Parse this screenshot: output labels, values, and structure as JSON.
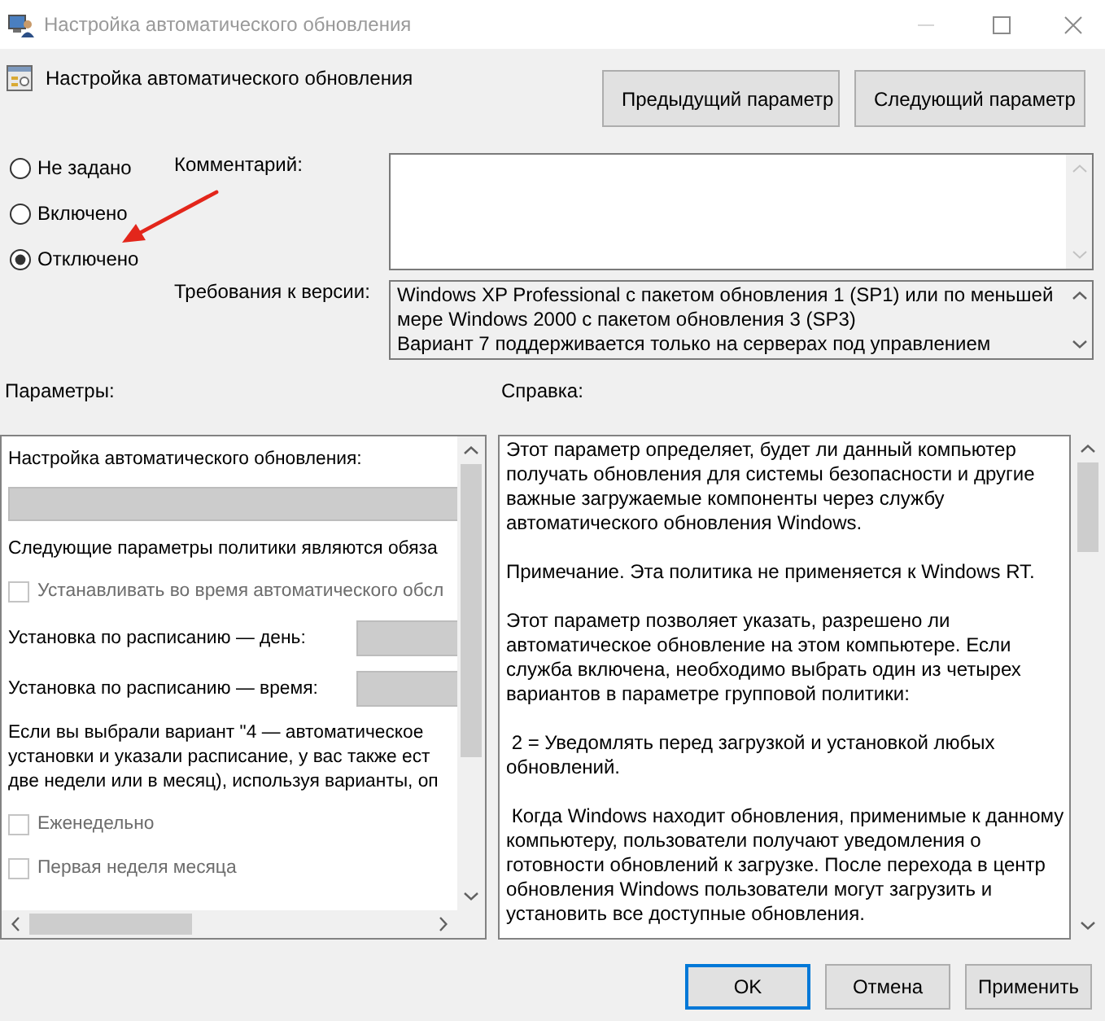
{
  "window": {
    "title": "Настройка автоматического обновления"
  },
  "header": {
    "title": "Настройка автоматического обновления",
    "buttons": [
      "Предыдущий параметр",
      "Следующий параметр"
    ]
  },
  "state_options": [
    {
      "label": "Не задано",
      "selected": false
    },
    {
      "label": "Включено",
      "selected": false
    },
    {
      "label": "Отключено",
      "selected": true
    }
  ],
  "comment": {
    "label": "Комментарий:"
  },
  "version": {
    "label": "Требования к версии:",
    "text": "Windows XP Professional с пакетом обновления 1 (SP1) или по меньшей\nмере Windows 2000 с пакетом обновления 3 (SP3)\nВариант 7 поддерживается только на серверах под управлением"
  },
  "options_panel": {
    "label": "Параметры:",
    "items": [
      {
        "kind": "label",
        "text": "Настройка автоматического обновления:"
      },
      {
        "kind": "dropdown",
        "disabled": true
      },
      {
        "kind": "label",
        "text": "Следующие параметры политики являются обяза"
      },
      {
        "kind": "checkbox",
        "label": "Устанавливать во время автоматического обсл",
        "checked": false,
        "disabled": true
      },
      {
        "kind": "dropdown",
        "label": "Установка по расписанию — день:",
        "disabled": true
      },
      {
        "kind": "dropdown",
        "label": "Установка по расписанию — время:",
        "disabled": true
      },
      {
        "kind": "paragraph",
        "text": "Если вы выбрали вариант \"4 — автоматическое\nустановки и указали расписание, у вас также ест\nдве недели или в месяц), используя варианты, оп"
      },
      {
        "kind": "checkbox",
        "label": "Еженедельно",
        "checked": false,
        "disabled": true
      },
      {
        "kind": "checkbox",
        "label": "Первая неделя месяца",
        "checked": false,
        "disabled": true
      }
    ]
  },
  "help_panel": {
    "label": "Справка:",
    "paragraphs": [
      "Этот параметр определяет, будет ли данный компьютер\nполучать обновления для системы безопасности и другие\nважные загружаемые компоненты через службу\nавтоматического обновления Windows.",
      "Примечание. Эта политика не применяется к Windows RT.",
      "Этот параметр позволяет указать, разрешено ли\nавтоматическое обновление на этом компьютере. Если\nслужба включена, необходимо выбрать один из четырех\nвариантов в параметре групповой политики:",
      " 2 = Уведомлять перед загрузкой и установкой любых\nобновлений.",
      " Когда Windows находит обновления, применимые к данному\nкомпьютеру, пользователи получают уведомления о\nготовности обновлений к загрузке. После перехода в центр\nобновления Windows пользователи могут загрузить и\nустановить все доступные обновления."
    ]
  },
  "buttons": [
    {
      "label": "OK",
      "default": true
    },
    {
      "label": "Отмена",
      "default": false
    },
    {
      "label": "Применить",
      "default": false
    }
  ]
}
